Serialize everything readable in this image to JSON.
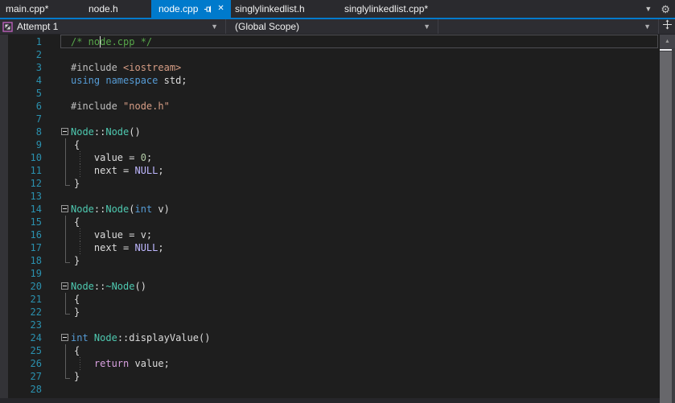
{
  "tab_bar": {
    "tabs": [
      {
        "label": "main.cpp*",
        "active": false,
        "modified": true
      },
      {
        "label": "node.h",
        "active": false,
        "modified": false
      },
      {
        "label": "node.cpp",
        "active": true,
        "modified": false
      },
      {
        "label": "singlylinkedlist.h",
        "active": false,
        "modified": false
      },
      {
        "label": "singlylinkedlist.cpp*",
        "active": false,
        "modified": true
      }
    ],
    "active_tab_icons": [
      "pin-icon",
      "close-icon"
    ],
    "right_icons": [
      "chevron-down-icon",
      "gear-icon"
    ],
    "active_tab_color": "#007acc"
  },
  "nav_bar": {
    "project_dropdown": {
      "label": "Attempt 1",
      "icon": "project-icon"
    },
    "scope_dropdown": {
      "label": "(Global Scope)"
    },
    "member_dropdown": {
      "label": ""
    },
    "split_button_icon": "split-editor-icon"
  },
  "editor": {
    "language": "cpp",
    "file": "node.cpp",
    "cursor": {
      "line": 1,
      "column": 6
    },
    "colors": {
      "background": "#1e1e1e",
      "accent": "#007acc",
      "line_number": "#2b91af",
      "comment": "#57a64a",
      "keyword": "#569cd6",
      "type": "#4ec9b0",
      "string": "#d69d85",
      "number": "#b5cea8",
      "macro": "#beb7ff",
      "control_keyword": "#d8a0df",
      "plain_text": "#dcdcdc",
      "preprocessor": "#bfbfbf"
    },
    "lines": [
      {
        "n": 1,
        "current": true,
        "seg": [
          [
            "/* node.cpp */",
            "comment"
          ]
        ]
      },
      {
        "n": 2,
        "seg": []
      },
      {
        "n": 3,
        "seg": [
          [
            "#include ",
            "preprocessor"
          ],
          [
            "<iostream>",
            "string"
          ]
        ]
      },
      {
        "n": 4,
        "seg": [
          [
            "using",
            "keyword"
          ],
          [
            " ",
            "plain"
          ],
          [
            "namespace",
            "keyword"
          ],
          [
            " std;",
            "plain"
          ]
        ]
      },
      {
        "n": 5,
        "seg": []
      },
      {
        "n": 6,
        "seg": [
          [
            "#include ",
            "preprocessor"
          ],
          [
            "\"node.h\"",
            "string"
          ]
        ]
      },
      {
        "n": 7,
        "seg": []
      },
      {
        "n": 8,
        "fold": true,
        "seg": [
          [
            "Node",
            "type"
          ],
          [
            "::",
            "plain"
          ],
          [
            "Node",
            "type"
          ],
          [
            "()",
            "plain"
          ]
        ]
      },
      {
        "n": 9,
        "ol": "v",
        "brace": true,
        "seg": [
          [
            "{",
            "plain"
          ]
        ]
      },
      {
        "n": 10,
        "ol": "v",
        "guide": true,
        "seg": [
          [
            "    value = ",
            "plain"
          ],
          [
            "0",
            "number"
          ],
          [
            ";",
            "plain"
          ]
        ]
      },
      {
        "n": 11,
        "ol": "v",
        "guide": true,
        "seg": [
          [
            "    next = ",
            "plain"
          ],
          [
            "NULL",
            "macro"
          ],
          [
            ";",
            "plain"
          ]
        ]
      },
      {
        "n": 12,
        "ol": "L",
        "brace": true,
        "seg": [
          [
            "}",
            "plain"
          ]
        ]
      },
      {
        "n": 13,
        "seg": []
      },
      {
        "n": 14,
        "fold": true,
        "seg": [
          [
            "Node",
            "type"
          ],
          [
            "::",
            "plain"
          ],
          [
            "Node",
            "type"
          ],
          [
            "(",
            "plain"
          ],
          [
            "int",
            "keyword"
          ],
          [
            " v)",
            "plain"
          ]
        ]
      },
      {
        "n": 15,
        "ol": "v",
        "brace": true,
        "seg": [
          [
            "{",
            "plain"
          ]
        ]
      },
      {
        "n": 16,
        "ol": "v",
        "guide": true,
        "seg": [
          [
            "    value = v;",
            "plain"
          ]
        ]
      },
      {
        "n": 17,
        "ol": "v",
        "guide": true,
        "seg": [
          [
            "    next = ",
            "plain"
          ],
          [
            "NULL",
            "macro"
          ],
          [
            ";",
            "plain"
          ]
        ]
      },
      {
        "n": 18,
        "ol": "L",
        "brace": true,
        "seg": [
          [
            "}",
            "plain"
          ]
        ]
      },
      {
        "n": 19,
        "seg": []
      },
      {
        "n": 20,
        "fold": true,
        "seg": [
          [
            "Node",
            "type"
          ],
          [
            "::",
            "plain"
          ],
          [
            "~Node",
            "type"
          ],
          [
            "()",
            "plain"
          ]
        ]
      },
      {
        "n": 21,
        "ol": "v",
        "brace": true,
        "seg": [
          [
            "{",
            "plain"
          ]
        ]
      },
      {
        "n": 22,
        "ol": "L",
        "brace": true,
        "seg": [
          [
            "}",
            "plain"
          ]
        ]
      },
      {
        "n": 23,
        "seg": []
      },
      {
        "n": 24,
        "fold": true,
        "seg": [
          [
            "int",
            "keyword"
          ],
          [
            " ",
            "plain"
          ],
          [
            "Node",
            "type"
          ],
          [
            "::displayValue()",
            "plain"
          ]
        ]
      },
      {
        "n": 25,
        "ol": "v",
        "brace": true,
        "seg": [
          [
            "{",
            "plain"
          ]
        ]
      },
      {
        "n": 26,
        "ol": "v",
        "guide": true,
        "seg": [
          [
            "    ",
            "plain"
          ],
          [
            "return",
            "control"
          ],
          [
            " value;",
            "plain"
          ]
        ]
      },
      {
        "n": 27,
        "ol": "L",
        "brace": true,
        "seg": [
          [
            "}",
            "plain"
          ]
        ]
      },
      {
        "n": 28,
        "seg": []
      }
    ]
  }
}
